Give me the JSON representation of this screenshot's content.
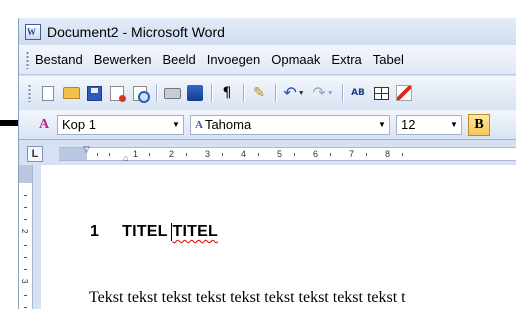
{
  "window": {
    "title": "Document2 - Microsoft Word",
    "app_icon_letter": "W"
  },
  "menu": {
    "items": [
      "Bestand",
      "Bewerken",
      "Beeld",
      "Invoegen",
      "Opmaak",
      "Extra",
      "Tabel"
    ]
  },
  "toolbar": {
    "icons": [
      "new-document-icon",
      "open-icon",
      "save-icon",
      "permission-icon",
      "print-preview-icon",
      "print-icon",
      "research-icon",
      "show-formatting-icon",
      "format-painter-icon",
      "undo-icon",
      "redo-icon",
      "insert-hyperlink-icon",
      "insert-table-icon",
      "drawing-icon"
    ],
    "show_formatting_glyph": "¶",
    "hyperlink_glyph": "AB"
  },
  "formatting": {
    "style": "Kop 1",
    "style_glyph": "A",
    "font": "Tahoma",
    "size": "12",
    "bold_label": "B"
  },
  "ruler": {
    "tab_selector": "L",
    "numbers": [
      "1",
      "2",
      "3",
      "4",
      "5",
      "6",
      "7",
      "8"
    ],
    "vertical_numbers": [
      "2",
      "3"
    ]
  },
  "document": {
    "heading_number": "1",
    "heading_word_1": "TITEL",
    "heading_word_2": "TITEL",
    "body": "Tekst tekst tekst tekst tekst tekst tekst tekst tekst t"
  },
  "colors": {
    "chrome": "#d6e2f3",
    "spellcheck": "#e00000",
    "bold_active": "#f8c45a"
  }
}
